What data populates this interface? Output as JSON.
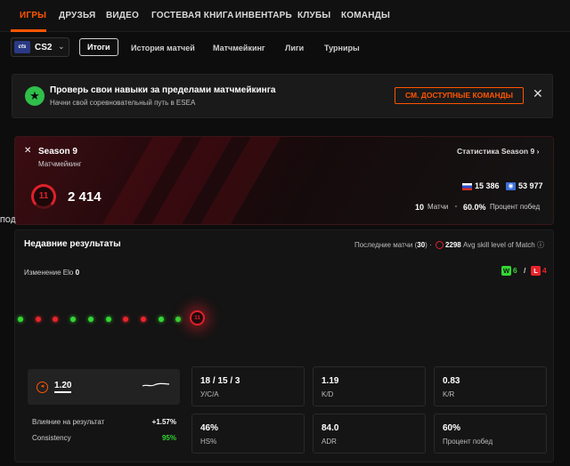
{
  "nav": {
    "tabs": [
      "ИГРЫ",
      "ДРУЗЬЯ",
      "ВИДЕО",
      "ГОСТЕВАЯ КНИГА",
      "ИНВЕНТАРЬ",
      "КЛУБЫ",
      "КОМАНДЫ"
    ],
    "active": "ИГРЫ"
  },
  "game_selector": {
    "logo": "cts",
    "name": "CS2"
  },
  "subtabs": [
    "Итоги",
    "История матчей",
    "Матчмейкинг",
    "Лиги",
    "Турниры"
  ],
  "banner": {
    "title": "Проверь свои навыки за пределами матчмейкинга",
    "subtitle": "Начни свой соревновательный путь в ESEA",
    "cta": "СМ. ДОСТУПНЫЕ КОМАНДЫ",
    "close": "✕"
  },
  "season": {
    "title": "Season 9",
    "mode": "Матчмейкинг",
    "link": "Статистика Season 9",
    "level": "11",
    "elo": "2 414",
    "country_rank": "15 386",
    "world_rank": "53 977",
    "matches": "10",
    "matches_label": "Матчи",
    "winrate": "60.0%",
    "winrate_label": "Процент побед"
  },
  "edge_text": "ПОД",
  "recent": {
    "title": "Недавние результаты",
    "info_prefix": "Последние матчи (",
    "info_count": "30",
    "info_suffix": ")",
    "avg_elo": "2298",
    "avg_label": "Avg skill level of Match",
    "elo_change_label": "Изменение Elo",
    "elo_change_value": "0",
    "wins_badge": "W",
    "wins": "6",
    "sep": "/",
    "losses_badge": "L",
    "losses": "4",
    "results": [
      "W",
      "L",
      "L",
      "W",
      "W",
      "W",
      "L",
      "L",
      "W",
      "W"
    ],
    "current_level": "11"
  },
  "stats": {
    "kd_value": "1.20",
    "impact_label": "Влияние на результат",
    "impact_value": "+1.57%",
    "consistency_label": "Consistency",
    "consistency_value": "95%",
    "cards": [
      {
        "value": "18 / 15 / 3",
        "label": "У/С/А"
      },
      {
        "value": "1.19",
        "label": "K/D"
      },
      {
        "value": "0.83",
        "label": "K/R"
      },
      {
        "value": "46%",
        "label": "HS%"
      },
      {
        "value": "84.0",
        "label": "ADR"
      },
      {
        "value": "60%",
        "label": "Процент побед"
      }
    ]
  },
  "colors": {
    "accent": "#ff5500",
    "win": "#33d733",
    "loss": "#e8242c",
    "level": "#e0202a"
  }
}
